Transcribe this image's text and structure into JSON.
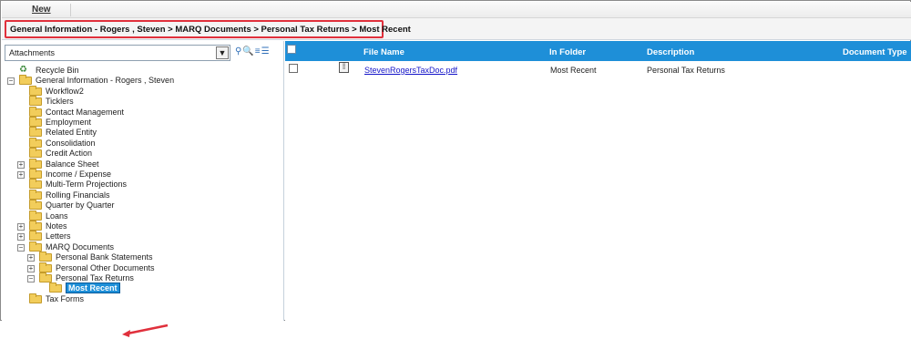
{
  "toolbar": {
    "new_label": "New"
  },
  "breadcrumb": "General Information - Rogers , Steven > MARQ Documents > Personal Tax Returns > Most Recent",
  "left_panel": {
    "dropdown_value": "Attachments",
    "tree": [
      {
        "label": "Recycle Bin",
        "icon": "recycle-bin-icon",
        "level": 0,
        "expander": ""
      },
      {
        "label": "General Information - Rogers , Steven",
        "icon": "folder-open-icon",
        "level": 0,
        "expander": "−"
      },
      {
        "label": "Workflow2",
        "icon": "folder-icon",
        "level": 1,
        "expander": ""
      },
      {
        "label": "Ticklers",
        "icon": "folder-icon",
        "level": 1,
        "expander": ""
      },
      {
        "label": "Contact Management",
        "icon": "folder-icon",
        "level": 1,
        "expander": ""
      },
      {
        "label": "Employment",
        "icon": "folder-icon",
        "level": 1,
        "expander": ""
      },
      {
        "label": "Related Entity",
        "icon": "folder-icon",
        "level": 1,
        "expander": ""
      },
      {
        "label": "Consolidation",
        "icon": "folder-icon",
        "level": 1,
        "expander": ""
      },
      {
        "label": "Credit Action",
        "icon": "folder-icon",
        "level": 1,
        "expander": ""
      },
      {
        "label": "Balance Sheet",
        "icon": "folder-icon",
        "level": 1,
        "expander": "+"
      },
      {
        "label": "Income / Expense",
        "icon": "folder-icon",
        "level": 1,
        "expander": "+"
      },
      {
        "label": "Multi-Term Projections",
        "icon": "folder-icon",
        "level": 1,
        "expander": ""
      },
      {
        "label": "Rolling Financials",
        "icon": "folder-icon",
        "level": 1,
        "expander": ""
      },
      {
        "label": "Quarter by Quarter",
        "icon": "folder-icon",
        "level": 1,
        "expander": ""
      },
      {
        "label": "Loans",
        "icon": "folder-icon",
        "level": 1,
        "expander": ""
      },
      {
        "label": "Notes",
        "icon": "folder-icon",
        "level": 1,
        "expander": "+"
      },
      {
        "label": "Letters",
        "icon": "folder-icon",
        "level": 1,
        "expander": "+"
      },
      {
        "label": "MARQ Documents",
        "icon": "folder-open-icon",
        "level": 1,
        "expander": "−"
      },
      {
        "label": "Personal Bank Statements",
        "icon": "folder-icon",
        "level": 2,
        "expander": "+"
      },
      {
        "label": "Personal Other Documents",
        "icon": "folder-icon",
        "level": 2,
        "expander": "+"
      },
      {
        "label": "Personal Tax Returns",
        "icon": "folder-open-icon",
        "level": 2,
        "expander": "−"
      },
      {
        "label": "Most Recent",
        "icon": "folder-open-icon",
        "level": 3,
        "expander": "",
        "selected": true
      },
      {
        "label": "Tax Forms",
        "icon": "folder-icon",
        "level": 1,
        "expander": ""
      }
    ]
  },
  "grid": {
    "headers": [
      "File Name",
      "In Folder",
      "Description",
      "Document Type"
    ],
    "rows": [
      {
        "file_name": "StevenRogersTaxDoc.pdf",
        "in_folder": "Most Recent",
        "description": "Personal Tax Returns",
        "document_type": ""
      }
    ]
  },
  "colors": {
    "header_blue": "#1e8fd8",
    "highlight_red": "#e0303c",
    "link_blue": "#1414c8"
  }
}
